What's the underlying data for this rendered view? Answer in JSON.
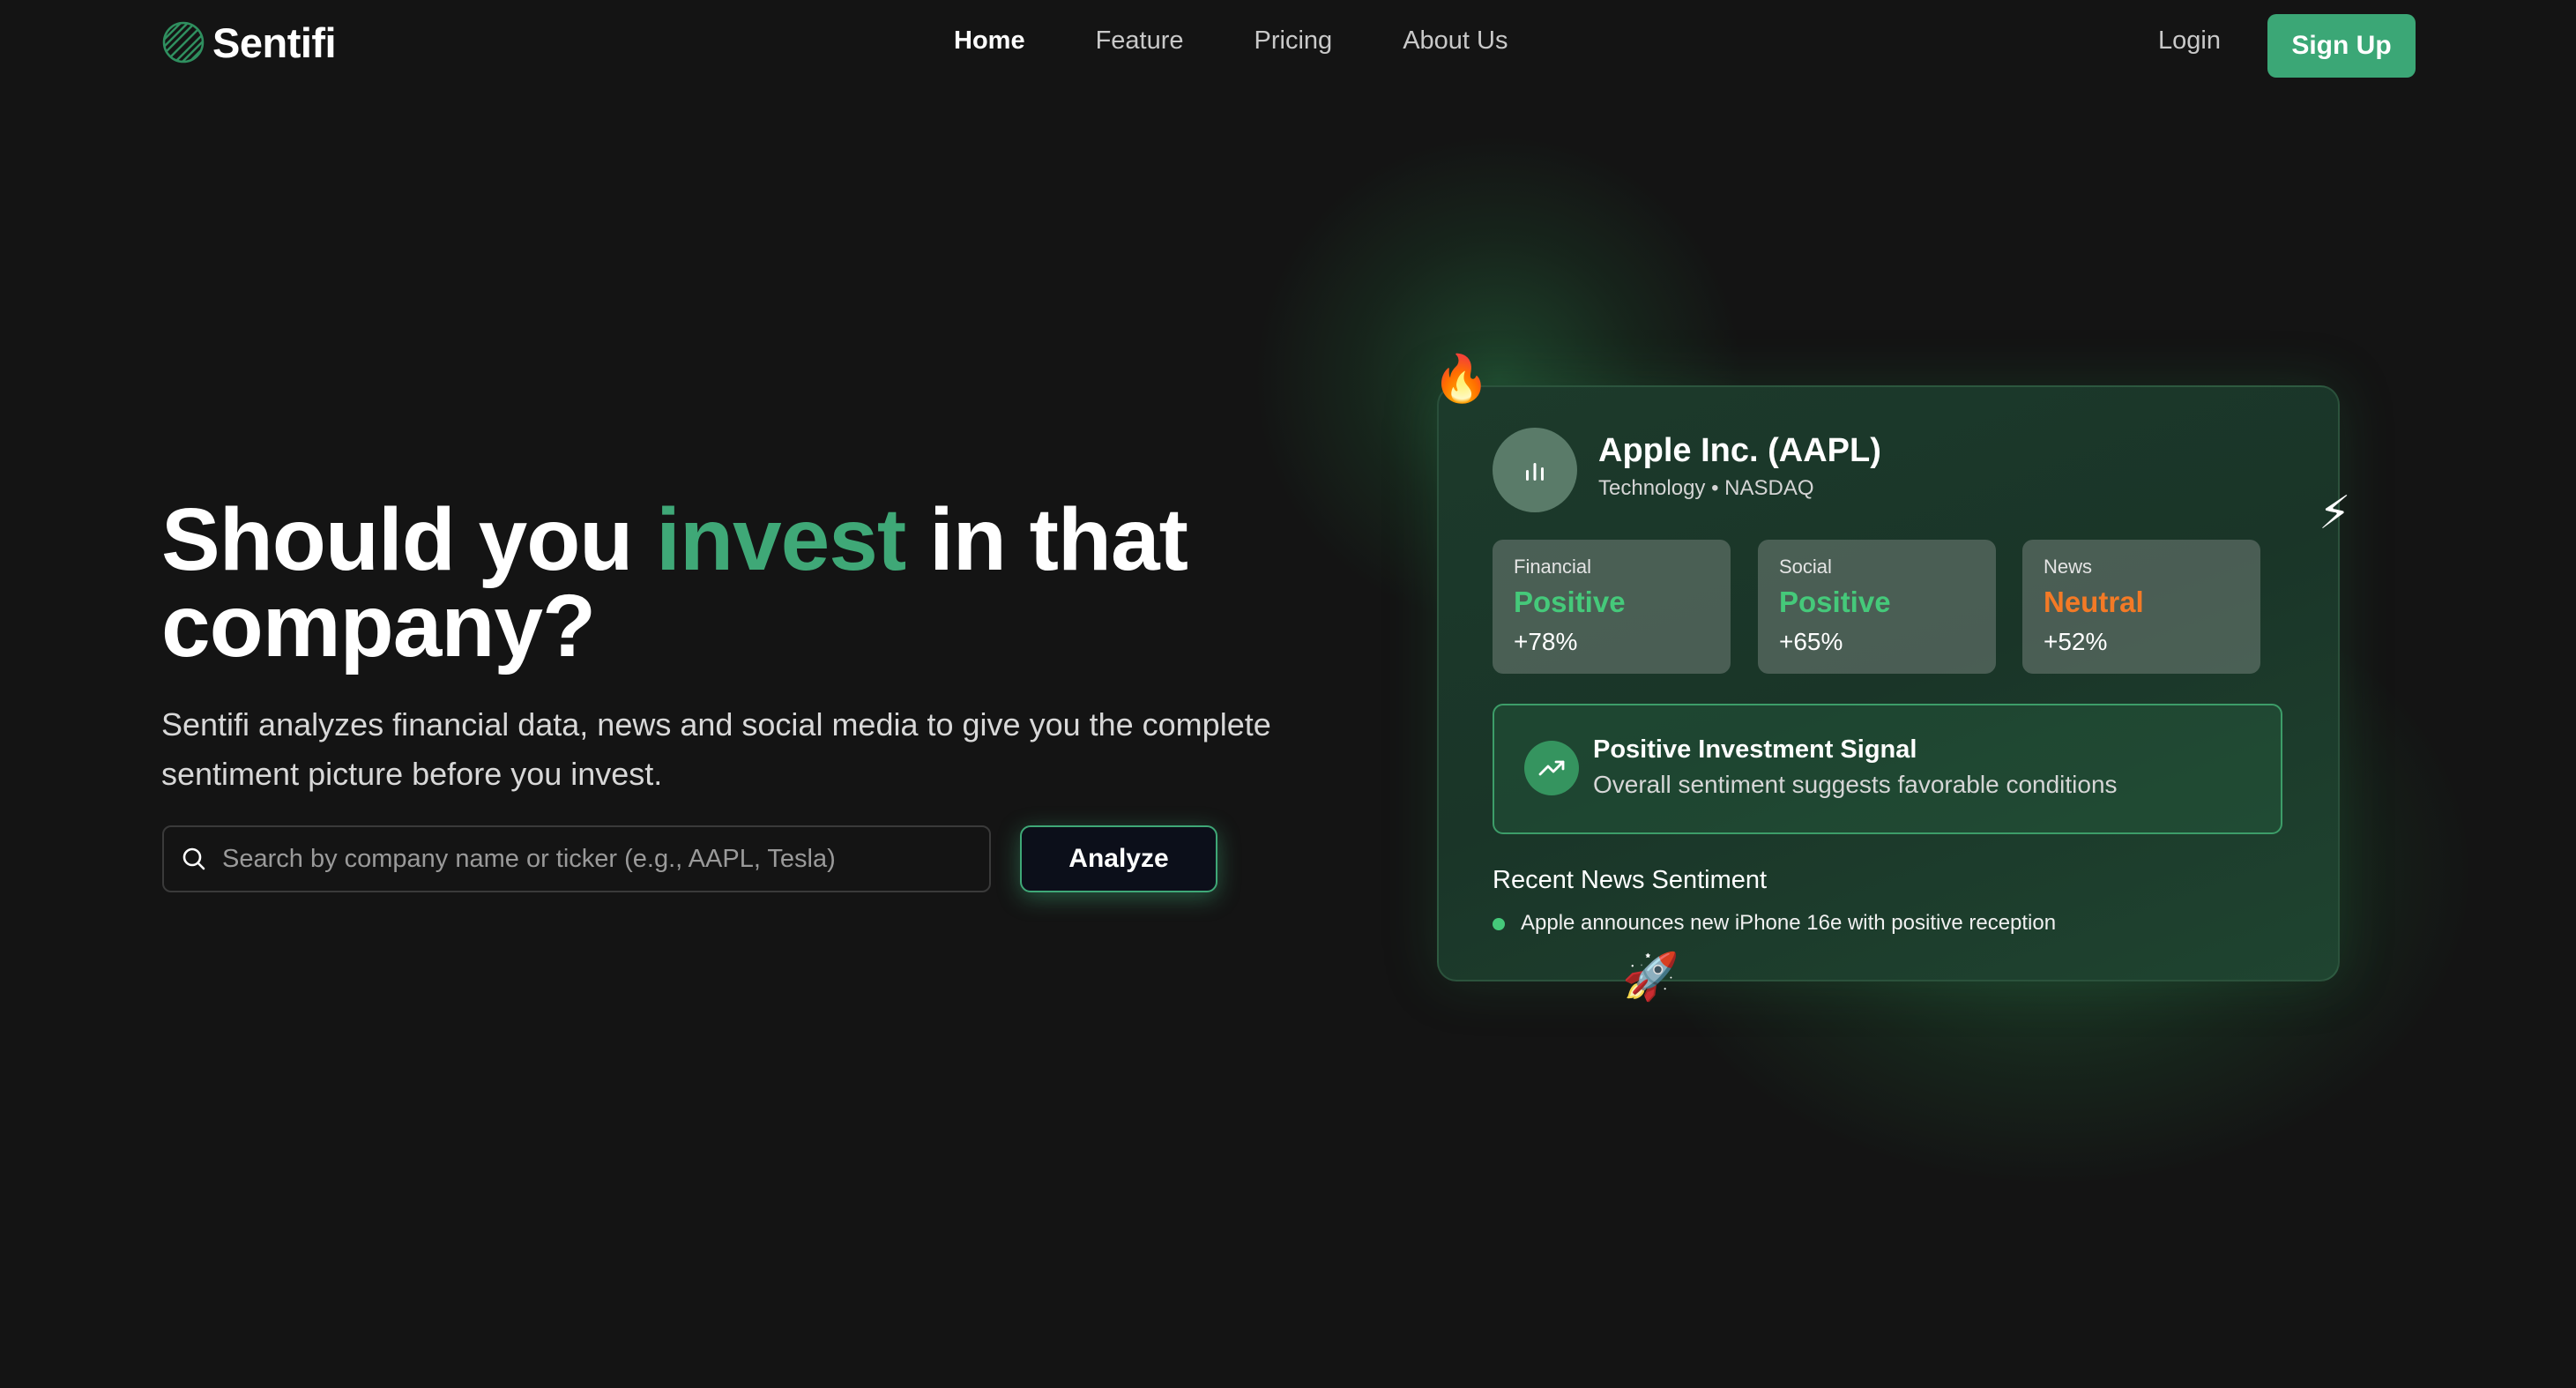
{
  "brand": {
    "name": "Sentifi",
    "logo_icon": "striped-globe-icon",
    "accent_color": "#3fa877"
  },
  "nav": {
    "links": [
      {
        "label": "Home",
        "active": true
      },
      {
        "label": "Feature",
        "active": false
      },
      {
        "label": "Pricing",
        "active": false
      },
      {
        "label": "About Us",
        "active": false
      }
    ],
    "login_label": "Login",
    "signup_label": "Sign Up"
  },
  "hero": {
    "title_part1": "Should you ",
    "title_accent": "invest",
    "title_part2": " in that company?",
    "subtitle": "Sentifi analyzes financial data, news and social media to give you the complete sentiment picture before you invest.",
    "search_placeholder": "Search by company name or ticker (e.g., AAPL, Tesla)",
    "search_value": "",
    "analyze_label": "Analyze"
  },
  "card": {
    "company_icon": "bar-chart-icon",
    "company_name": "Apple Inc. (AAPL)",
    "company_meta": "Technology • NASDAQ",
    "metrics": [
      {
        "label": "Financial",
        "value": "Positive",
        "percent": "+78%",
        "status_color": "#45c97a"
      },
      {
        "label": "Social",
        "value": "Positive",
        "percent": "+65%",
        "status_color": "#45c97a"
      },
      {
        "label": "News",
        "value": "Neutral",
        "percent": "+52%",
        "status_color": "#f37a26"
      }
    ],
    "signal": {
      "icon": "trending-up-icon",
      "title": "Positive Investment Signal",
      "subtitle": "Overall sentiment suggests favorable conditions"
    },
    "news_heading": "Recent News Sentiment",
    "news_items": [
      {
        "text": "Apple announces new iPhone 16e with positive reception",
        "sentiment_color": "#45c97a"
      }
    ],
    "decorations": {
      "fire": "🔥",
      "bolt": "⚡",
      "rocket": "🚀"
    }
  }
}
